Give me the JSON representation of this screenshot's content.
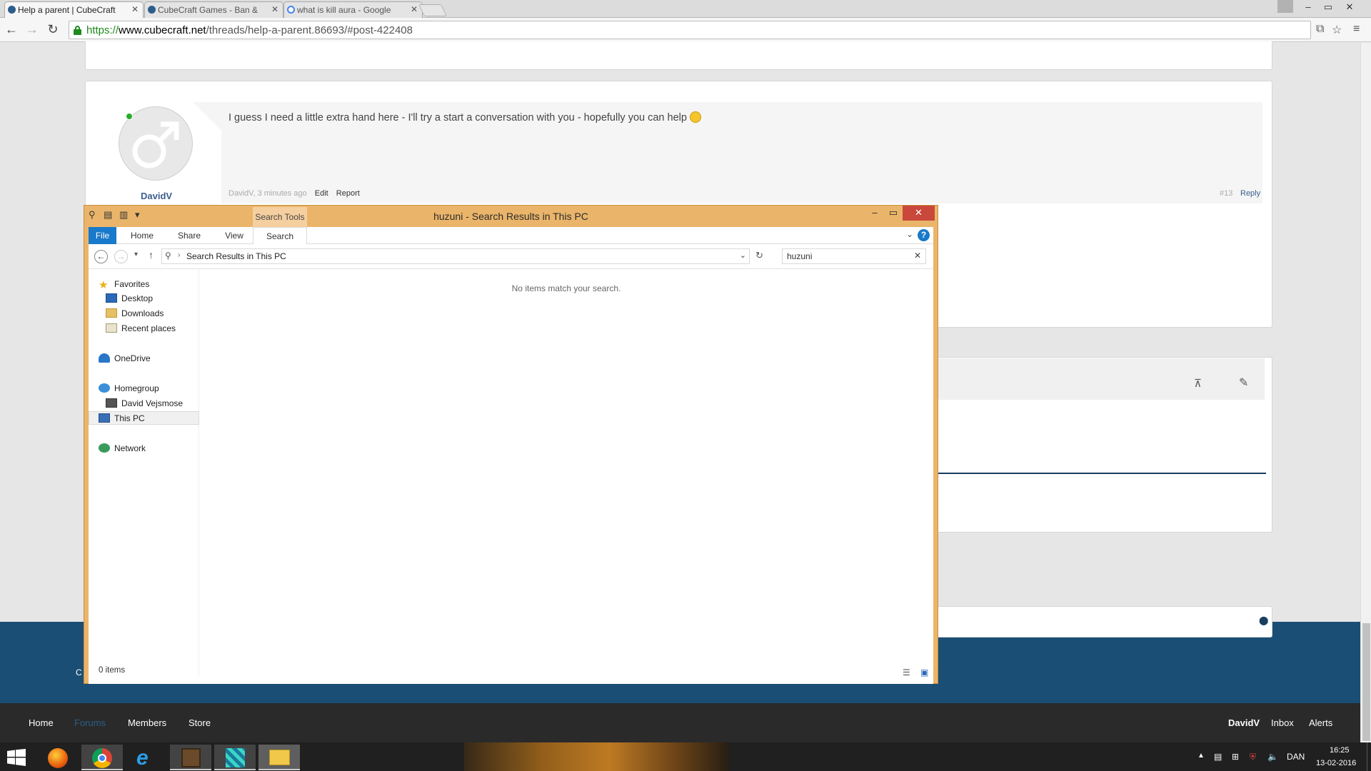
{
  "browser": {
    "tabs": [
      {
        "title": "Help a parent | CubeCraft",
        "active": true
      },
      {
        "title": "CubeCraft Games - Ban &",
        "active": false
      },
      {
        "title": "what is kill aura - Google",
        "active": false
      }
    ],
    "url_scheme": "https://",
    "url_host": "www.cubecraft.net",
    "url_path": "/threads/help-a-parent.86693/#post-422408",
    "window_controls": {
      "minimize": "–",
      "restore": "▭",
      "close": "✕"
    }
  },
  "post": {
    "username": "DavidV",
    "message": "I guess I need a little extra hand here - I'll try a start a conversation with you - hopefully you can help",
    "meta_author_time": "DavidV, 3 minutes ago",
    "edit_label": "Edit",
    "report_label": "Report",
    "post_number": "#13",
    "reply_label": "Reply"
  },
  "footer_partial": "C",
  "footer_nav": {
    "home": "Home",
    "forums": "Forums",
    "members": "Members",
    "store": "Store",
    "user": "DavidV",
    "inbox": "Inbox",
    "alerts": "Alerts"
  },
  "explorer": {
    "title": "huzuni - Search Results in This PC",
    "context_tab": "Search Tools",
    "ribbon_tabs": [
      "File",
      "Home",
      "Share",
      "View",
      "Search"
    ],
    "address": "Search Results in This PC",
    "search_value": "huzuni",
    "empty_message": "No items match your search.",
    "status": "0 items",
    "nav": {
      "favorites": "Favorites",
      "desktop": "Desktop",
      "downloads": "Downloads",
      "recent": "Recent places",
      "onedrive": "OneDrive",
      "homegroup": "Homegroup",
      "homegroup_user": "David Vejsmose",
      "thispc": "This PC",
      "network": "Network"
    }
  },
  "taskbar": {
    "language": "DAN",
    "time": "16:25",
    "date": "13-02-2016"
  },
  "colors": {
    "explorer_frame": "#eab56a",
    "file_tab": "#1979ca",
    "footer_blue": "#1a4e74",
    "footer_nav": "#2a2a2a",
    "link": "#3b5e8c"
  }
}
